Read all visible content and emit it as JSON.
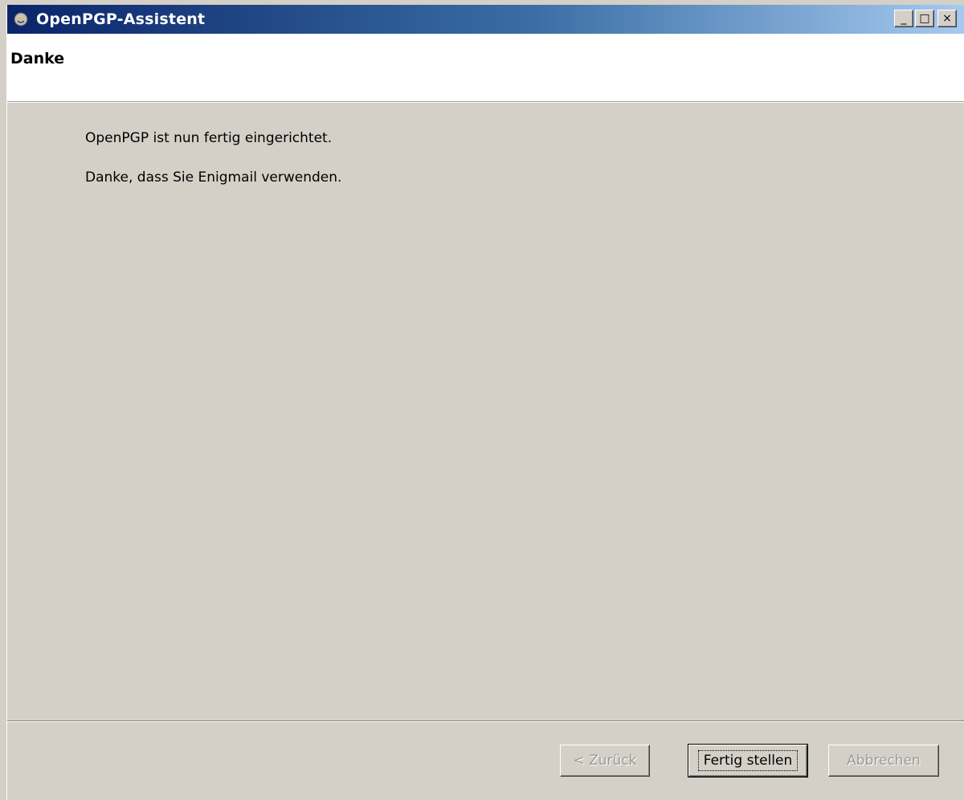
{
  "window": {
    "title": "OpenPGP-Assistent",
    "caption_minimize": "_",
    "caption_maximize": "□",
    "caption_close": "×"
  },
  "header": {
    "title": "Danke"
  },
  "content": {
    "line1": "OpenPGP ist nun fertig eingerichtet.",
    "line2": "Danke, dass Sie Enigmail verwenden."
  },
  "buttons": {
    "back": "< Zurück",
    "finish": "Fertig stellen",
    "cancel": "Abbrechen"
  },
  "colors": {
    "titlebar_start": "#0a246a",
    "titlebar_end": "#a6caf0",
    "dialog_bg": "#d4d0c8",
    "disabled_text": "#9a9a96"
  }
}
